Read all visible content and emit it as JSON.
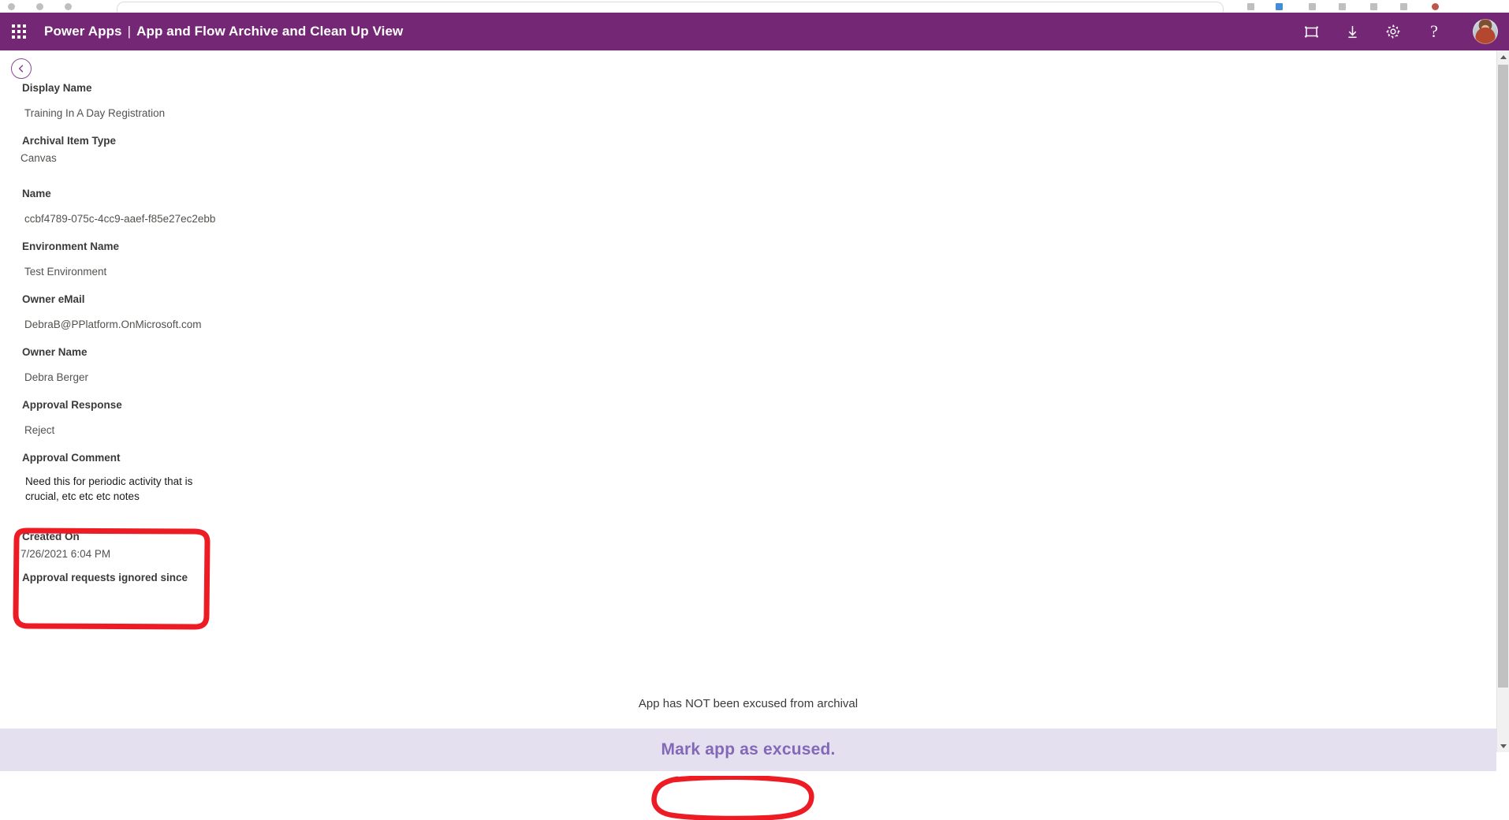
{
  "browser": {
    "omnibox_value": ""
  },
  "header": {
    "waffle_icon": "app-launcher-grid-icon",
    "brand": "Power Apps",
    "separator": "|",
    "page_title": "App and Flow Archive and Clean Up View",
    "icons": [
      {
        "name": "fullscreen-icon",
        "label": "Fullscreen"
      },
      {
        "name": "download-icon",
        "label": "Download"
      },
      {
        "name": "gear-icon",
        "label": "Settings"
      },
      {
        "name": "help-icon",
        "label": "?"
      }
    ],
    "avatar_label": "Account",
    "brand_color": "#742774"
  },
  "back_button": {
    "icon": "chevron-left-icon",
    "label": "Back"
  },
  "form": {
    "fields": [
      {
        "label": "Display Name",
        "value": "Training In A Day Registration"
      },
      {
        "label": "Archival Item Type",
        "value": "Canvas"
      },
      {
        "label": "Name",
        "value": "ccbf4789-075c-4cc9-aaef-f85e27ec2ebb"
      },
      {
        "label": "Environment Name",
        "value": "Test Environment"
      },
      {
        "label": "Owner eMail",
        "value": "DebraB@PPlatform.OnMicrosoft.com"
      },
      {
        "label": "Owner Name",
        "value": "Debra Berger"
      },
      {
        "label": "Approval Response",
        "value": "Reject"
      },
      {
        "label": "Approval Comment",
        "value": "Need this for periodic activity that is crucial, etc etc etc notes"
      },
      {
        "label": "Created On",
        "value": "7/26/2021 6:04 PM"
      },
      {
        "label": "Approval requests ignored since",
        "value": ""
      }
    ]
  },
  "status": {
    "text": "App has NOT been excused from archival"
  },
  "action_bar": {
    "button_label": "Mark app as excused.",
    "background_color": "#e5e0f0",
    "text_color": "#8468b8"
  },
  "annotations": {
    "color": "#ed1c24",
    "comment_box_target": "Approval Comment field",
    "oval_target": "Mark app as excused. button"
  },
  "scrollbar": {
    "up_arrow": "scroll-up-arrow-icon",
    "down_arrow": "scroll-down-arrow-icon"
  }
}
